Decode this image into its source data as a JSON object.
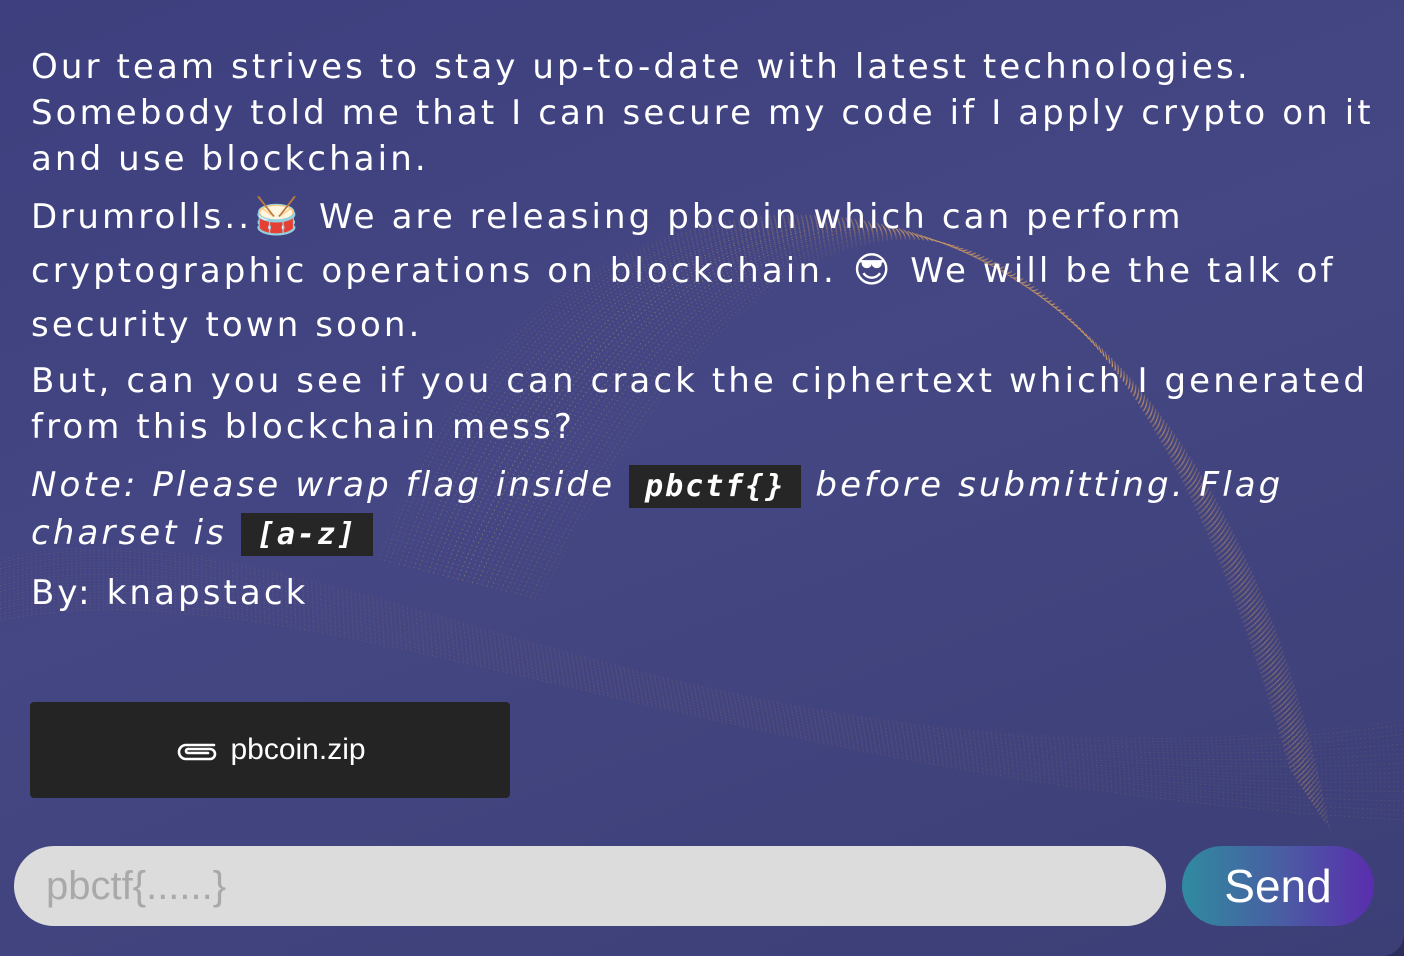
{
  "challenge": {
    "paragraph1": "Our team strives to stay up-to-date with latest technologies. Somebody told me that I can secure my code if I apply crypto on it and use blockchain.",
    "paragraph2_part1": "Drumrolls..",
    "paragraph2_emoji1": "🥁",
    "paragraph2_part2": "We are releasing pbcoin which can perform cryptographic operations on blockchain.",
    "paragraph2_emoji2": "😎",
    "paragraph2_part3": "We will be the talk of security town soon.",
    "paragraph3": "But, can you see if you can crack the ciphertext which I generated from this blockchain mess?",
    "note_part1": "Note: Please wrap flag inside",
    "note_code1": "pbctf{}",
    "note_part2": "before submitting. Flag charset is",
    "note_code2": "[a-z]",
    "author": "By: knapstack"
  },
  "attachment": {
    "icon": "paperclip-icon",
    "filename": "pbcoin.zip"
  },
  "submission": {
    "placeholder": "pbctf{......}",
    "value": "",
    "send_label": "Send"
  },
  "colors": {
    "panel_background": "#424480",
    "file_button_background": "#242424",
    "input_background": "#dcdcdc",
    "send_gradient_start": "#2f8ba0",
    "send_gradient_end": "#5a2dae",
    "art_gold": "#d9b84a",
    "art_pink": "#c06a9a"
  }
}
